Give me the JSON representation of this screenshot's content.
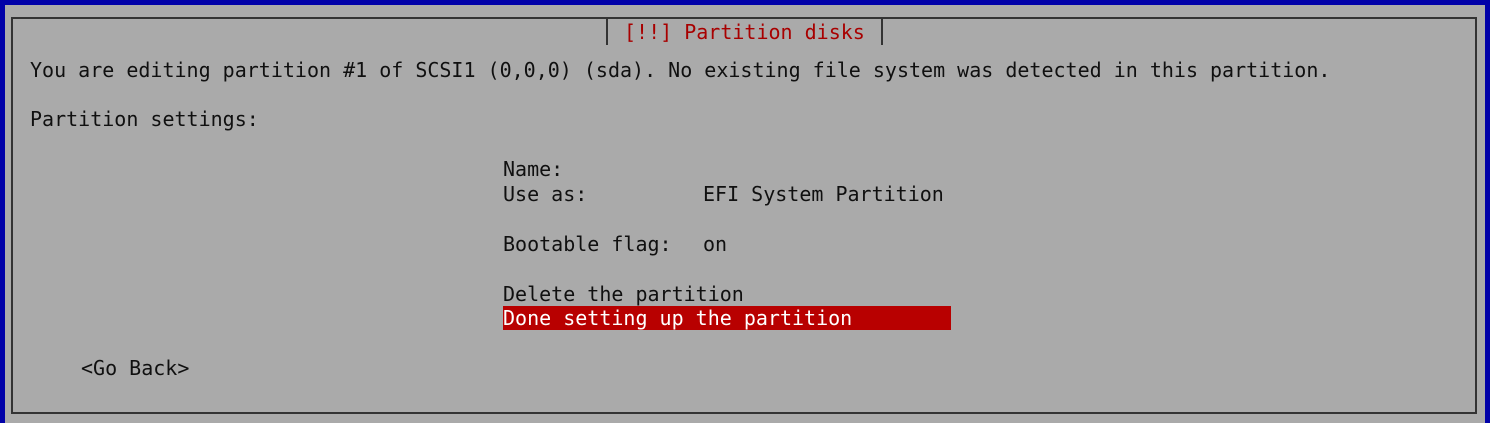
{
  "dialog": {
    "title": "[!!] Partition disks",
    "description": "You are editing partition #1 of SCSI1 (0,0,0) (sda). No existing file system was detected in this partition.",
    "settings_heading": "Partition settings:"
  },
  "settings": {
    "name_label": "Name:",
    "name_value": "",
    "use_as_label": "Use as:",
    "use_as_value": "EFI System Partition",
    "bootable_label": "Bootable flag:",
    "bootable_value": "on",
    "delete_label": "Delete the partition",
    "done_label": "Done setting up the partition"
  },
  "buttons": {
    "go_back": "<Go Back>"
  },
  "colors": {
    "background": "#0000a8",
    "dialog": "#aaaaaa",
    "title_text": "#a80000",
    "highlight": "#b80000"
  }
}
